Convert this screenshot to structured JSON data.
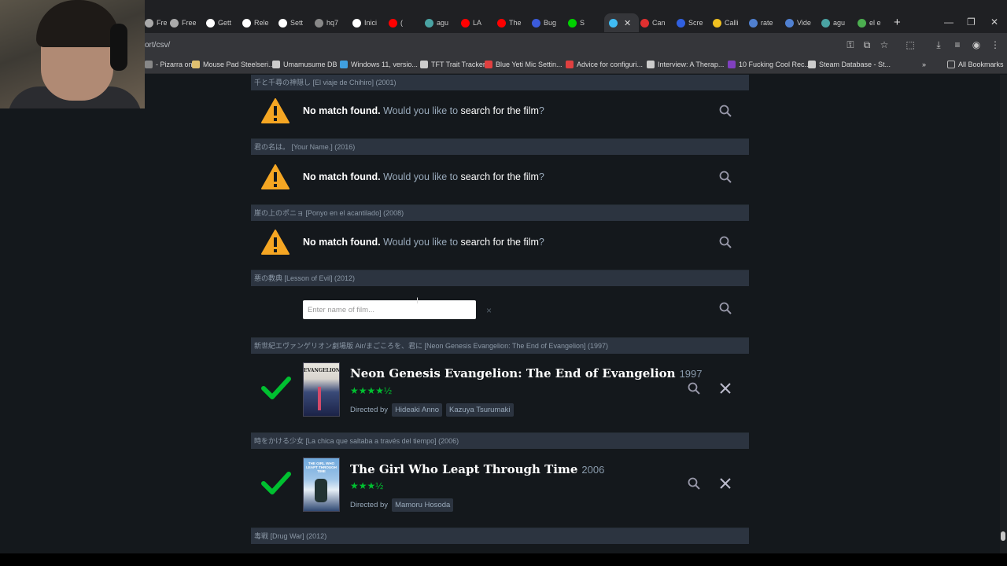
{
  "browser": {
    "tabs": [
      {
        "label": "Free",
        "color": "#aaaaaa"
      },
      {
        "label": "Free",
        "color": "#aaaaaa"
      },
      {
        "label": "Gett",
        "color": "#ffffff"
      },
      {
        "label": "Rele",
        "color": "#ffffff"
      },
      {
        "label": "Sett",
        "color": "#ffffff"
      },
      {
        "label": "hq7",
        "color": "#888888"
      },
      {
        "label": "Inici",
        "color": "#ffffff"
      },
      {
        "label": "(",
        "color": "#ff0000"
      },
      {
        "label": "agu",
        "color": "#4aa3a3"
      },
      {
        "label": "LA",
        "color": "#ff0000"
      },
      {
        "label": "The",
        "color": "#ff0000"
      },
      {
        "label": "Bug",
        "color": "#3b5bdb"
      },
      {
        "label": "S",
        "color": "#00d000"
      },
      {
        "label": "",
        "color": "#40bcf4"
      },
      {
        "label": "Can",
        "color": "#e03030"
      },
      {
        "label": "Scre",
        "color": "#3060e0"
      },
      {
        "label": "Calli",
        "color": "#f0c020"
      },
      {
        "label": "rate",
        "color": "#5080d0"
      },
      {
        "label": "Vide",
        "color": "#5080d0"
      },
      {
        "label": "agu",
        "color": "#4aa3a3"
      },
      {
        "label": "el e",
        "color": "#4caf50"
      }
    ],
    "url": "ort/csv/",
    "bookmarks": [
      {
        "label": "- Pizarra on...",
        "color": "#888"
      },
      {
        "label": "Mouse Pad Steelseri...",
        "color": "#e0c070"
      },
      {
        "label": "Umamusume DB",
        "color": "#cccccc"
      },
      {
        "label": "Windows 11, versio...",
        "color": "#40a0e0"
      },
      {
        "label": "TFT Trait Tracker",
        "color": "#cccccc"
      },
      {
        "label": "Blue Yeti Mic Settin...",
        "color": "#e04040"
      },
      {
        "label": "Advice for configuri...",
        "color": "#e04040"
      },
      {
        "label": "Interview: A Therap...",
        "color": "#cccccc"
      },
      {
        "label": "10 Fucking Cool Rec...",
        "color": "#8040c0"
      },
      {
        "label": "Steam Database - St...",
        "color": "#cccccc"
      }
    ],
    "all_bookmarks": "All Bookmarks",
    "more_bookmarks": "»"
  },
  "import": {
    "rows": [
      {
        "source": "千と千尋の神隠し [El viaje de Chihiro] (2001)",
        "status": "nomatch"
      },
      {
        "source": "君の名は。 [Your Name.] (2016)",
        "status": "nomatch"
      },
      {
        "source": "崖の上のポニョ [Ponyo en el acantilado] (2008)",
        "status": "nomatch"
      },
      {
        "source": "悪の教典 [Lesson of Evil] (2012)",
        "status": "search"
      },
      {
        "source": "新世紀エヴァンゲリオン劇場版 Air/まごころを、君に [Neon Genesis Evangelion: The End of Evangelion] (1997)",
        "status": "matched"
      },
      {
        "source": "時をかける少女 [La chica que saltaba a través del tiempo] (2006)",
        "status": "matched"
      },
      {
        "source": "毒戦 [Drug War] (2012)",
        "status": "pending"
      }
    ],
    "nomatch": {
      "bold": "No match found.",
      "text": " Would you like to ",
      "link": "search for the film",
      "end": "?"
    },
    "search_placeholder": "Enter name of film...",
    "clear": "×",
    "directed_by": "Directed by",
    "films": [
      {
        "title": "Neon Genesis Evangelion: The End of Evangelion",
        "year": "1997",
        "rating_stars": "★★★★½",
        "rating": 4.5,
        "directors": [
          "Hideaki Anno",
          "Kazuya Tsurumaki"
        ],
        "poster_text": "EVANGELION"
      },
      {
        "title": "The Girl Who Leapt Through Time",
        "year": "2006",
        "rating_stars": "★★★½",
        "rating": 3.5,
        "directors": [
          "Mamoru Hosoda"
        ],
        "poster_text": "THE GIRL WHO LEAPT THROUGH TIME"
      }
    ]
  },
  "colors": {
    "accent_green": "#00c030",
    "warning_orange": "#f5a623",
    "page_bg": "#14181c",
    "strip_bg": "#2c3440"
  }
}
